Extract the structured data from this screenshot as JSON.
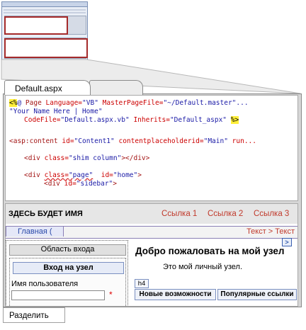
{
  "tabs": {
    "active": "Default.aspx"
  },
  "code": {
    "line1": {
      "open": "<%",
      "at": "@",
      "directive": "Page",
      "attr1": "Language=",
      "val1": "\"VB\"",
      "attr2": "MasterPageFile=",
      "val2": "\"~/Default.master\"...",
      "end": ""
    },
    "line2": {
      "val": "\"Your Name Here | Home\""
    },
    "line3": {
      "attr1": "CodeFile=",
      "val1": "\"Default.aspx.vb\"",
      "attr2": "Inherits=",
      "val2": "\"Default_aspx\"",
      "close": "%>"
    },
    "line4": {
      "tag": "<asp:content",
      "attr1": "id=",
      "val1": "\"Content1\"",
      "attr2": "contentplaceholderid=",
      "val2": "\"Main\"",
      "rest": "run..."
    },
    "line5": {
      "tag": "<div",
      "attr": "class=",
      "val": "\"shim column\"",
      "end": "></div>"
    },
    "line6": {
      "tag": "<div",
      "attr1": "class=",
      "val1": "\"page\"",
      "attr2": "id=",
      "val2": "\"home\"",
      "end": ">"
    },
    "line7": {
      "tag": "<div",
      "attr": "id=",
      "val": "\"sidebar\"",
      "end": ">"
    }
  },
  "design": {
    "site_name": "ЗДЕСЬ БУДЕТ ИМЯ",
    "links": [
      "Ссылка 1",
      "Ссылка 2",
      "Ссылка 3"
    ],
    "nav_home": "Главная (",
    "breadcrumb": "Текст > Текст",
    "login_area": "Область входа",
    "login_button": "Вход на узел",
    "username_label": "Имя пользователя",
    "required_mark": "*",
    "welcome": "Добро пожаловать на мой узел",
    "personal": "Это мой личный узел.",
    "h4_tag": "h4",
    "feature_new": "Новые возможности",
    "feature_popular": "Популярные ссылки",
    "nav_glyph": ">"
  },
  "split_button": "Разделить",
  "colors": {
    "link": "#c0392b",
    "code_blue": "#1a1aa6",
    "code_value": "#a31515",
    "highlight": "#ffef3a"
  }
}
